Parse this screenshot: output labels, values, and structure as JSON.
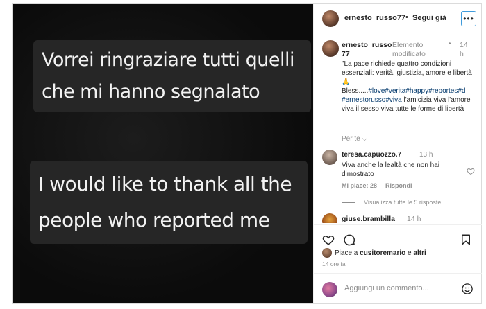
{
  "media": {
    "line1": "Vorrei ringraziare tutti quelli",
    "line2": "che mi hanno segnalato",
    "line3": "I would like to thank all the",
    "line4": "people who reported me"
  },
  "header": {
    "username": "ernesto_russo77",
    "separator": "•",
    "follow_label": "Segui già",
    "more_icon": "more-options-icon"
  },
  "caption": {
    "username": "ernesto_russo 77",
    "edited": "Elemento modificato",
    "dot": "•",
    "time": "14 h",
    "text_intro": "\"La pace richiede quattro condizioni essenziali: verità, giustizia, amore e libertà🙏",
    "text_bless": "Bless.....",
    "hashtags": "#love#verita#happy#reportes#d #ernestorusso#viva",
    "text_tail": " l'amicizia viva l'amore viva il sesso viva tutte le forme di libertà",
    "see_translation": "Per te"
  },
  "comment": {
    "username": "teresa.capuozzo.7",
    "time": "13 h",
    "text": "Viva anche la lealtà che non hai dimostrato",
    "likes": "Mi piace: 28",
    "reply": "Rispondi",
    "view_replies": "Visualizza tutte le 5 risposte"
  },
  "comment2": {
    "username": "giuse.brambilla",
    "time": "14 h"
  },
  "footer": {
    "liked_prefix": "Piace a ",
    "liked_user": "cusitoremario",
    "liked_suffix": " e ",
    "liked_others": "altri",
    "time_ago": "14 ore fa",
    "comment_placeholder": "Aggiungi un commento..."
  }
}
